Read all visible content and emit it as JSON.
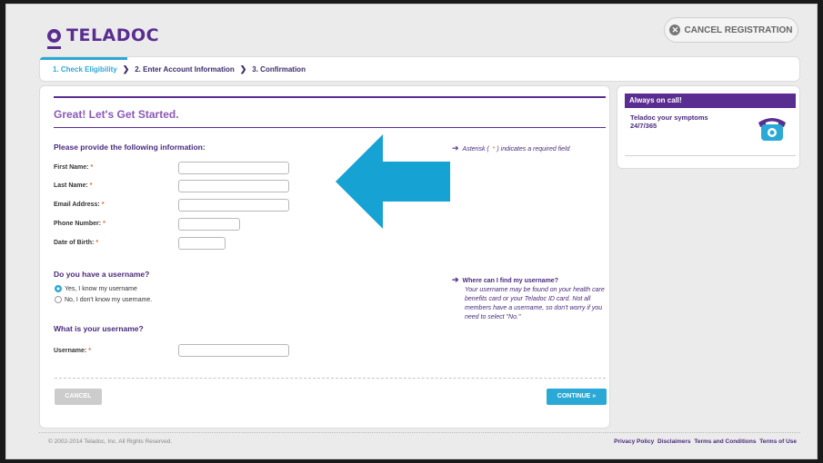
{
  "brand": {
    "name": "TELADOC"
  },
  "header": {
    "cancel_label": "CANCEL REGISTRATION"
  },
  "steps": [
    {
      "label": "1. Check Eligibility"
    },
    {
      "label": "2. Enter Account Information"
    },
    {
      "label": "3. Confirmation"
    }
  ],
  "form": {
    "heading": "Great! Let's Get Started.",
    "info_title": "Please provide the following information:",
    "required_note_pre": "Asterisk (",
    "required_note_star": "*",
    "required_note_post": ") indicates a required field",
    "fields": [
      {
        "label": "First Name:",
        "value": ""
      },
      {
        "label": "Last Name:",
        "value": ""
      },
      {
        "label": "Email Address:",
        "value": ""
      },
      {
        "label": "Phone Number:",
        "value": ""
      },
      {
        "label": "Date of Birth:",
        "value": ""
      }
    ],
    "required_star": "*",
    "username_question": "Do you have a username?",
    "radio_options": [
      {
        "label": "Yes, I know my username",
        "selected": true
      },
      {
        "label": "No, I don't know my username.",
        "selected": false
      }
    ],
    "help_title": "Where can I find my username?",
    "help_text": "Your username may be found on your health care benefits card or your Teladoc ID card. Not all members have a username, so don't worry if you need to select \"No.\"",
    "username_title": "What is your username?",
    "username_label": "Username:",
    "username_value": "",
    "cancel_label": "CANCEL",
    "continue_label": "CONTINUE »"
  },
  "side": {
    "title": "Always on call!",
    "text": "Teladoc your symptoms 24/7/365"
  },
  "footer": {
    "copyright": "© 2002-2014 Teladoc, Inc. All Rights Reserved.",
    "links": [
      "Privacy Policy",
      "Disclaimers",
      "Terms and Conditions",
      "Terms of Use"
    ]
  },
  "colors": {
    "brand_purple": "#5a2d91",
    "accent_blue": "#2aa9d6",
    "required_orange": "#e3662b"
  }
}
